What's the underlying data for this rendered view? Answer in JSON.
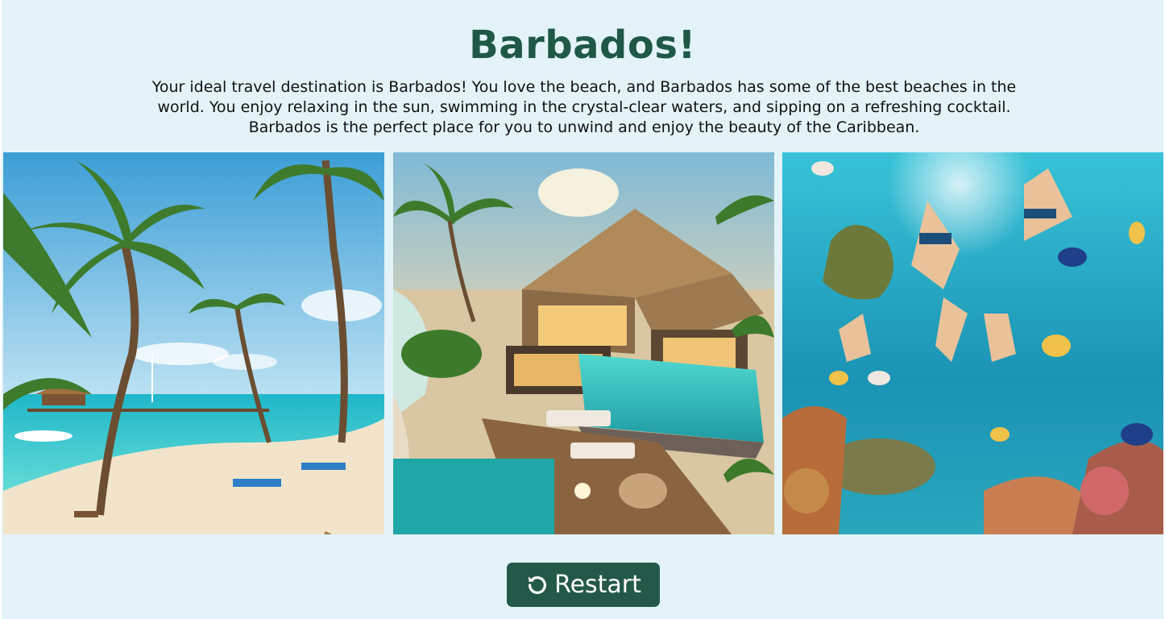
{
  "result": {
    "title": "Barbados!",
    "description": "Your ideal travel destination is Barbados! You love the beach, and Barbados has some of the best beaches in the world. You enjoy relaxing in the sun, swimming in the crystal-clear waters, and sipping on a refreshing cocktail. Barbados is the perfect place for you to unwind and enjoy the beauty of the Caribbean."
  },
  "gallery": {
    "images": [
      {
        "subject": "palm-beach"
      },
      {
        "subject": "luxury-villa-pool"
      },
      {
        "subject": "snorkeling-reef"
      }
    ]
  },
  "actions": {
    "restart_label": "Restart",
    "restart_icon": "rotate-ccw-icon"
  },
  "colors": {
    "background": "#e3f3f7",
    "title": "#1f5846",
    "button": "#24594a",
    "button_text": "#ffffff"
  }
}
